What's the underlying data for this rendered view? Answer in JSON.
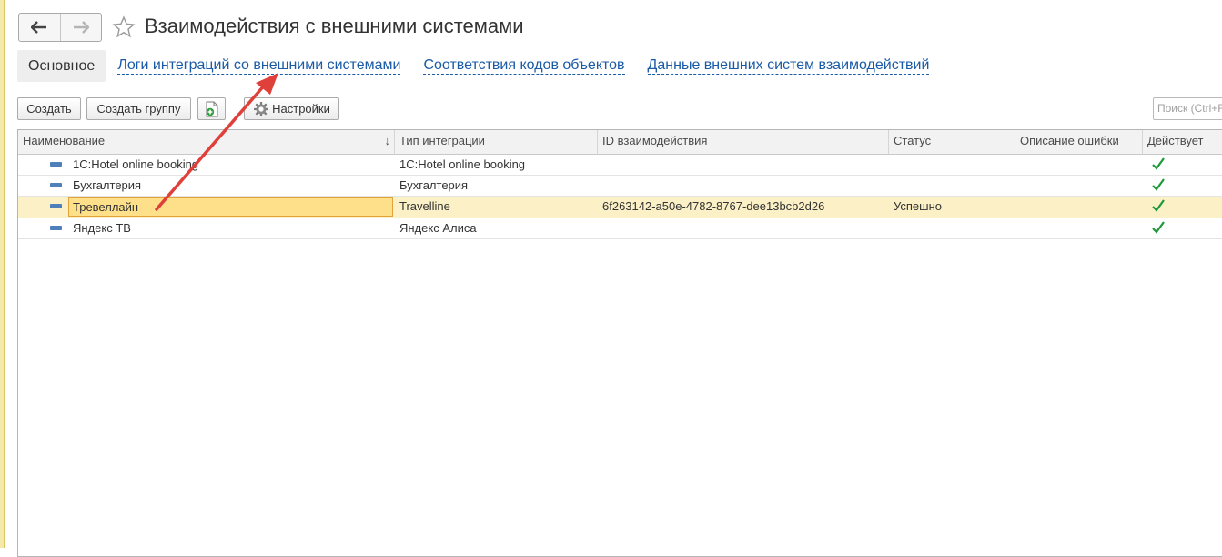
{
  "window": {
    "title": "Взаимодействия с внешними системами",
    "nav_back_icon": "arrow-left-icon",
    "nav_forward_icon": "arrow-right-icon",
    "favorite_icon": "star-icon"
  },
  "tabs": [
    {
      "label": "Основное",
      "active": true
    },
    {
      "label": "Логи интеграций со внешними системами",
      "active": false
    },
    {
      "label": "Соответствия кодов объектов",
      "active": false
    },
    {
      "label": "Данные внешних систем взаимодействий",
      "active": false
    }
  ],
  "toolbar": {
    "create_label": "Создать",
    "create_group_label": "Создать группу",
    "copy_icon": "document-add-icon",
    "settings_label": "Настройки",
    "settings_icon": "gear-icon",
    "search_placeholder": "Поиск (Ctrl+F)"
  },
  "table": {
    "columns": [
      "Наименование",
      "Тип интеграции",
      "ID взаимодействия",
      "Статус",
      "Описание ошибки",
      "Действует",
      ""
    ],
    "sort_indicator": "↓",
    "rows": [
      {
        "name": "1C:Hotel online booking",
        "type": "1C:Hotel online booking",
        "id": "",
        "status": "",
        "error": "",
        "active": true,
        "selected": false
      },
      {
        "name": "Бухгалтерия",
        "type": "Бухгалтерия",
        "id": "",
        "status": "",
        "error": "",
        "active": true,
        "selected": false
      },
      {
        "name": "Тревеллайн",
        "type": "Travelline",
        "id": "6f263142-a50e-4782-8767-dee13bcb2d26",
        "status": "Успешно",
        "error": "",
        "active": true,
        "selected": true
      },
      {
        "name": "Яндекс ТВ",
        "type": "Яндекс Алиса",
        "id": "",
        "status": "",
        "error": "",
        "active": true,
        "selected": false
      }
    ]
  },
  "colors": {
    "link": "#1a5aa6",
    "selected_row": "#fbf0c6",
    "editor_bg": "#ffe08a",
    "check": "#1e9a3a",
    "annotation_arrow": "#e0403a"
  }
}
